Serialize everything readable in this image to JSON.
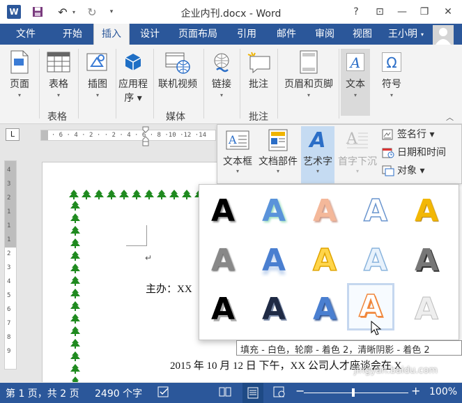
{
  "window": {
    "title": "企业内刊.docx - Word",
    "help": "?",
    "ribbon_options": "⊡",
    "minimize": "—",
    "restore": "❐",
    "close": "✕"
  },
  "quick_access": {
    "logo": "W",
    "undo": "↶",
    "redo": "↻"
  },
  "tabs": [
    "文件",
    "开始",
    "插入",
    "设计",
    "页面布局",
    "引用",
    "邮件",
    "审阅",
    "视图"
  ],
  "active_tab": "插入",
  "user": {
    "name": "王小明"
  },
  "ribbon": {
    "pages": "页面",
    "table": "表格",
    "table_group": "表格",
    "illustrations": "插图",
    "apps_line1": "应用程",
    "apps_line2": "序",
    "online_video": "联机视频",
    "media_group": "媒体",
    "links": "链接",
    "comment": "批注",
    "comment_group": "批注",
    "header_footer": "页眉和页脚",
    "text": "文本",
    "symbols": "符号"
  },
  "ruler": {
    "tab_selector": "L",
    "horizontal": "8 · 6 · 4 · 2 ·   · 2 · 4 · 6 · 8 ·10 ·12 ·14",
    "vertical": [
      "4",
      "3",
      "2",
      "1",
      "1",
      "1",
      "2",
      "3",
      "4",
      "5",
      "6",
      "7",
      "8",
      "9"
    ]
  },
  "text_panel": {
    "textbox": "文本框",
    "quick_parts": "文档部件",
    "wordart": "艺术字",
    "drop_cap": "首字下沉",
    "signature_line": "签名行",
    "date_time": "日期和时间",
    "object": "对象"
  },
  "wordart": {
    "glyph": "A",
    "tooltip": "填充 - 白色，轮廓 - 着色 2，清晰阴影 - 着色 2"
  },
  "document": {
    "para_mark": "↵",
    "host_line": "主办：XX",
    "body_line": "2015 年 10 月 12 日 下午，XX 公司人才座谈会在 X"
  },
  "status": {
    "page": "第 1 页，共 2 页",
    "words": "2490 个字",
    "zoom_minus": "−",
    "zoom_plus": "+",
    "zoom": "100%",
    "watermark": "jingyan.baidu.com"
  },
  "colors": {
    "accent": "#2b579a",
    "border_tree": "#1f8a1f",
    "wordart_orange": "#f0873c",
    "wordart_blue": "#4a7fd0",
    "wordart_gold": "#f2b705"
  }
}
